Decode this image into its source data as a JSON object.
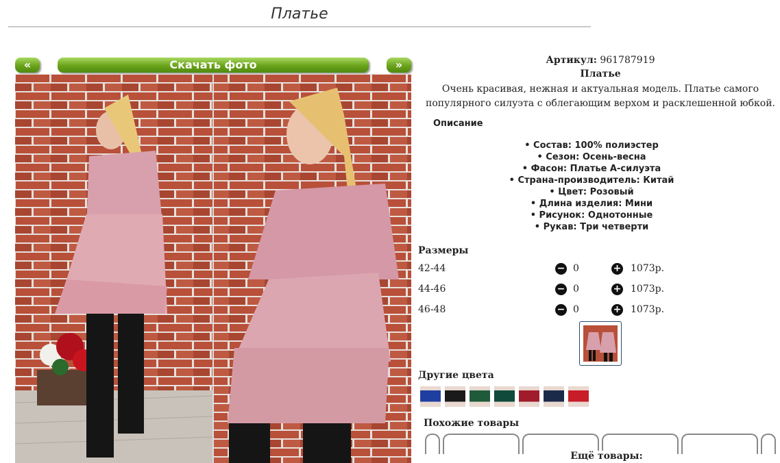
{
  "page": {
    "title": "Платье"
  },
  "gallery": {
    "prev_label": "«",
    "download_label": "Скачать фото",
    "next_label": "»"
  },
  "product": {
    "sku_label": "Артикул:",
    "sku_value": "961787919",
    "name": "Платье",
    "description": "Очень красивая, нежная и актуальная модель. Платье самого популярного силуэта с облегающим верхом и расклешенной юбкой.",
    "description_heading": "Описание",
    "properties": [
      "Состав: 100% полиэстер",
      "Сезон: Осень-весна",
      "Фасон: Платье А-силуэта",
      "Страна-производитель: Китай",
      "Цвет: Розовый",
      "Длина изделия: Мини",
      "Рисунок: Однотонные",
      "Рукав: Три четверти"
    ]
  },
  "sizes": {
    "heading": "Размеры",
    "rows": [
      {
        "size": "42-44",
        "minus": "−",
        "qty": "0",
        "plus": "+",
        "price": "1073р."
      },
      {
        "size": "44-46",
        "minus": "−",
        "qty": "0",
        "plus": "+",
        "price": "1073р."
      },
      {
        "size": "46-48",
        "minus": "−",
        "qty": "0",
        "plus": "+",
        "price": "1073р."
      }
    ]
  },
  "other_colors": {
    "heading": "Другие цвета",
    "swatches": [
      "#1f3fa0",
      "#1a1a1a",
      "#1f5a3a",
      "#0f4a3a",
      "#a01c2c",
      "#1c2a4a",
      "#c81c28"
    ]
  },
  "similar": {
    "heading": "Похожие товары"
  },
  "more": {
    "heading": "Ещё товары:"
  },
  "colors": {
    "accent_green": "#6aa21a",
    "dress_pink": "#d8a0ac",
    "brick": "#b8503a"
  }
}
